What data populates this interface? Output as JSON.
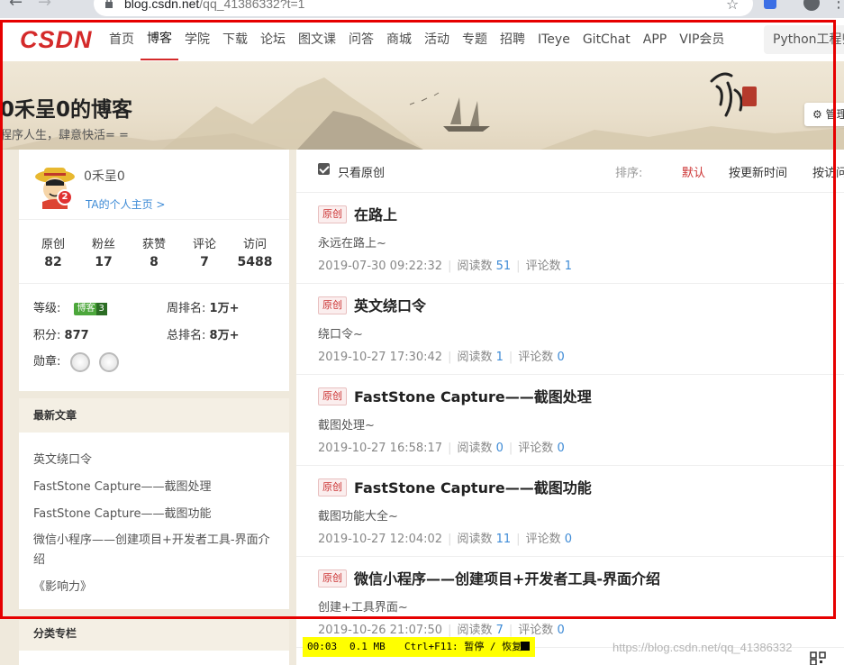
{
  "browser": {
    "url_host": "blog.csdn.net",
    "url_path": "/qq_41386332?t=1"
  },
  "nav": {
    "logo": "CSDN",
    "links": [
      "首页",
      "博客",
      "学院",
      "下载",
      "论坛",
      "图文课",
      "问答",
      "商城",
      "活动",
      "专题",
      "招聘",
      "ITeye",
      "GitChat",
      "APP",
      "VIP会员"
    ],
    "active_index": 1,
    "search_text": "Python工程师"
  },
  "banner": {
    "title": "0禾呈0的博客",
    "subtitle": "程序人生，肆意快活= =",
    "manage_label": "管理"
  },
  "profile": {
    "name": "0禾呈0",
    "home_link": "TA的个人主页 >",
    "avatar_badge": "2",
    "stats": [
      {
        "label": "原创",
        "value": "82"
      },
      {
        "label": "粉丝",
        "value": "17"
      },
      {
        "label": "获赞",
        "value": "8"
      },
      {
        "label": "评论",
        "value": "7"
      },
      {
        "label": "访问",
        "value": "5488"
      }
    ],
    "level_label": "等级:",
    "level_badge": "博客",
    "level_num": "3",
    "week_rank_label": "周排名:",
    "week_rank_value": "1万+",
    "points_label": "积分:",
    "points_value": "877",
    "total_rank_label": "总排名:",
    "total_rank_value": "8万+",
    "medals_label": "勋章:"
  },
  "recent": {
    "heading": "最新文章",
    "items": [
      "英文绕口令",
      "FastStone Capture——截图处理",
      "FastStone Capture——截图功能",
      "微信小程序——创建项目+开发者工具-界面介绍",
      "《影响力》"
    ]
  },
  "category": {
    "heading": "分类专栏"
  },
  "filter": {
    "only_original": "只看原创",
    "sort_label": "排序:",
    "sort_default": "默认",
    "sort_time": "按更新时间",
    "sort_visits": "按访问量"
  },
  "articles": [
    {
      "tag": "原创",
      "title": "在路上",
      "desc": "永远在路上~",
      "date": "2019-07-30 09:22:32",
      "read_label": "阅读数",
      "reads": "51",
      "comment_label": "评论数",
      "comments": "1"
    },
    {
      "tag": "原创",
      "title": "英文绕口令",
      "desc": "绕口令~",
      "date": "2019-10-27 17:30:42",
      "read_label": "阅读数",
      "reads": "1",
      "comment_label": "评论数",
      "comments": "0"
    },
    {
      "tag": "原创",
      "title": "FastStone Capture——截图处理",
      "desc": "截图处理~",
      "date": "2019-10-27 16:58:17",
      "read_label": "阅读数",
      "reads": "0",
      "comment_label": "评论数",
      "comments": "0"
    },
    {
      "tag": "原创",
      "title": "FastStone Capture——截图功能",
      "desc": "截图功能大全~",
      "date": "2019-10-27 12:04:02",
      "read_label": "阅读数",
      "reads": "11",
      "comment_label": "评论数",
      "comments": "0"
    },
    {
      "tag": "原创",
      "title": "微信小程序——创建项目+开发者工具-界面介绍",
      "desc": "创建+工具界面~",
      "date": "2019-10-26 21:07:50",
      "read_label": "阅读数",
      "reads": "7",
      "comment_label": "评论数",
      "comments": "0"
    }
  ],
  "recorder": {
    "time": "00:03",
    "size": "0.1 MB",
    "hint": "Ctrl+F11: 暂停 / 恢复"
  },
  "watermark": "https://blog.csdn.net/qq_41386332"
}
